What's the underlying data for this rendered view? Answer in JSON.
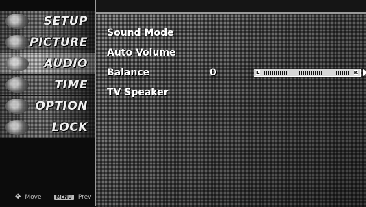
{
  "sidebar": {
    "items": [
      {
        "label": "SETUP",
        "icon": "setup-icon"
      },
      {
        "label": "PICTURE",
        "icon": "picture-icon"
      },
      {
        "label": "AUDIO",
        "icon": "audio-icon",
        "active": true
      },
      {
        "label": "TIME",
        "icon": "time-icon"
      },
      {
        "label": "OPTION",
        "icon": "option-icon"
      },
      {
        "label": "LOCK",
        "icon": "lock-icon"
      }
    ],
    "hints": {
      "move_label": "Move",
      "menu_key": "MENU",
      "prev_label": "Prev"
    }
  },
  "panel": {
    "options": [
      {
        "label": "Sound Mode"
      },
      {
        "label": "Auto Volume"
      },
      {
        "label": "Balance",
        "value": "0"
      },
      {
        "label": "TV Speaker"
      }
    ],
    "balance_slider": {
      "left_label": "L",
      "right_label": "R",
      "level": 0.5
    }
  }
}
